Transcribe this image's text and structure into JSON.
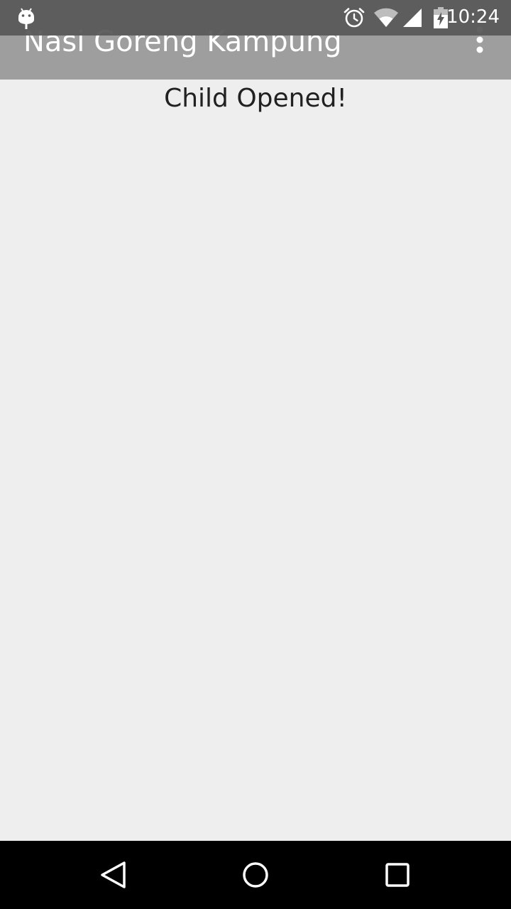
{
  "status_bar": {
    "time": "10:24",
    "icons": [
      "android-icon",
      "alarm-icon",
      "wifi-icon",
      "signal-icon",
      "battery-charging-icon"
    ]
  },
  "app_bar": {
    "title": "Nasi Goreng Kampung",
    "overflow_icon": "more-vert-icon"
  },
  "content": {
    "message": "Child Opened!"
  },
  "nav_bar": {
    "buttons": [
      "back-icon",
      "home-icon",
      "recents-icon"
    ]
  },
  "colors": {
    "app_bar": "#9e9e9e",
    "status_bar": "#5a5a5a",
    "background": "#eeeeee",
    "text": "#212121",
    "nav_bar": "#000000"
  }
}
